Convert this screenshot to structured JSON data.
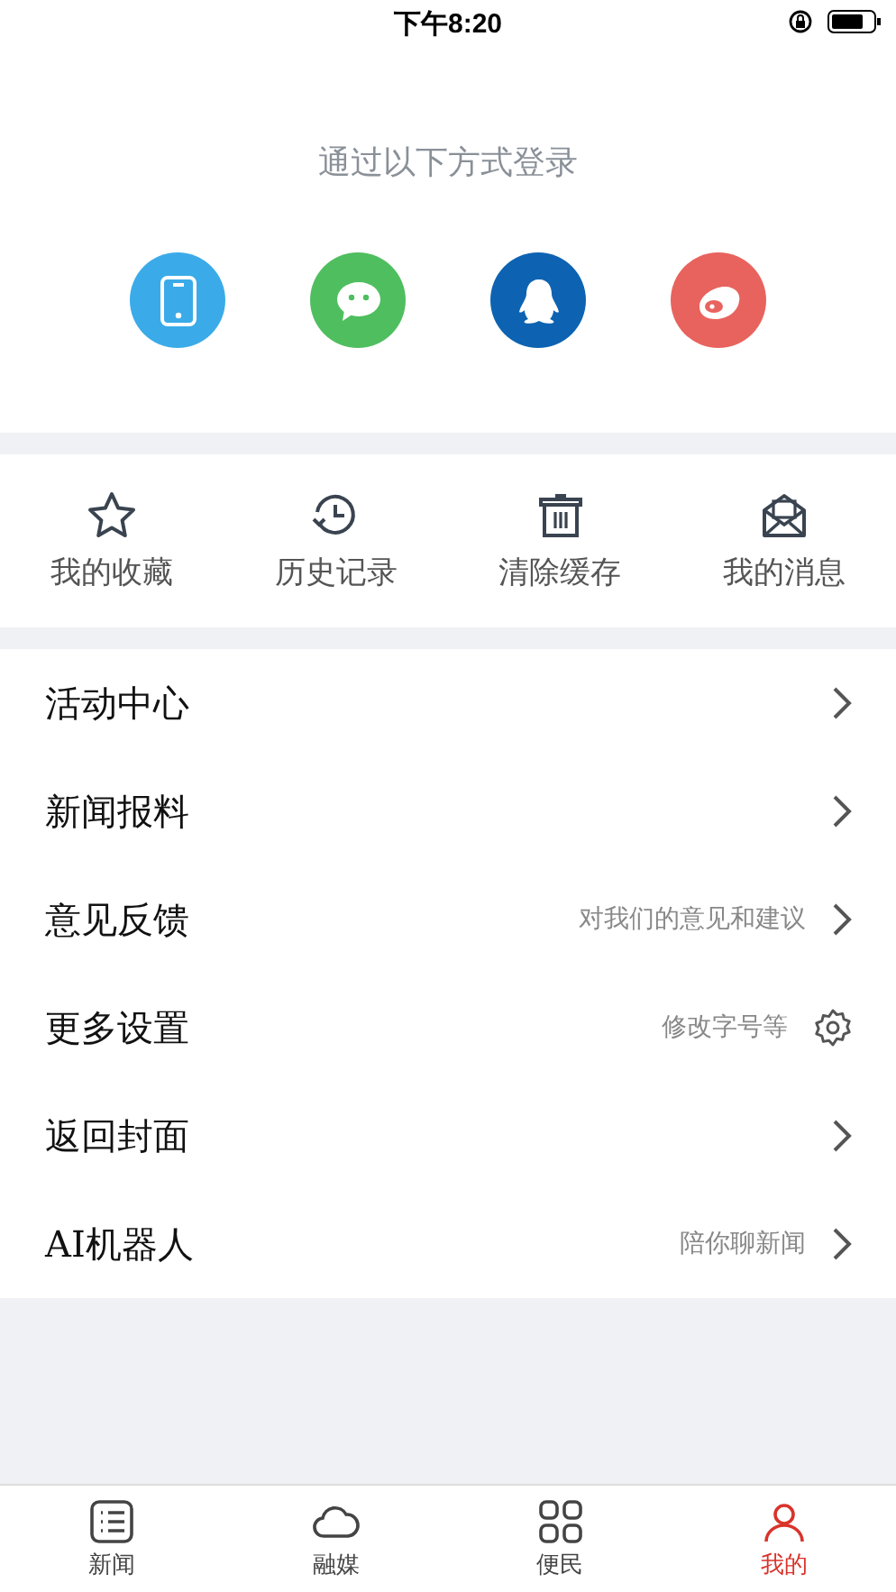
{
  "status_bar": {
    "time": "下午8:20"
  },
  "login": {
    "title": "通过以下方式登录",
    "methods": [
      {
        "kind": "phone",
        "color": "#3aabe8"
      },
      {
        "kind": "chat",
        "color": "#4fbe5f"
      },
      {
        "kind": "penguin",
        "color": "#0d63b2"
      },
      {
        "kind": "eye",
        "color": "#e8635e"
      }
    ]
  },
  "shortcuts": [
    {
      "kind": "star",
      "label": "我的收藏"
    },
    {
      "kind": "history",
      "label": "历史记录"
    },
    {
      "kind": "trash",
      "label": "清除缓存"
    },
    {
      "kind": "mail",
      "label": "我的消息"
    }
  ],
  "menu": [
    {
      "kind": "link",
      "label": "活动中心"
    },
    {
      "kind": "link",
      "label": "新闻报料"
    },
    {
      "kind": "link",
      "label": "意见反馈",
      "hint": "对我们的意见和建议"
    },
    {
      "kind": "settings",
      "label": "更多设置",
      "hint": "修改字号等"
    },
    {
      "kind": "link",
      "label": "返回封面"
    },
    {
      "kind": "link",
      "label": "AI机器人",
      "hint": "陪你聊新闻"
    }
  ],
  "tab_bar": [
    {
      "kind": "list",
      "label": "新闻",
      "selected": false
    },
    {
      "kind": "cloud",
      "label": "融媒",
      "selected": false
    },
    {
      "kind": "grid",
      "label": "便民",
      "selected": false
    },
    {
      "kind": "person",
      "label": "我的",
      "selected": true
    }
  ]
}
